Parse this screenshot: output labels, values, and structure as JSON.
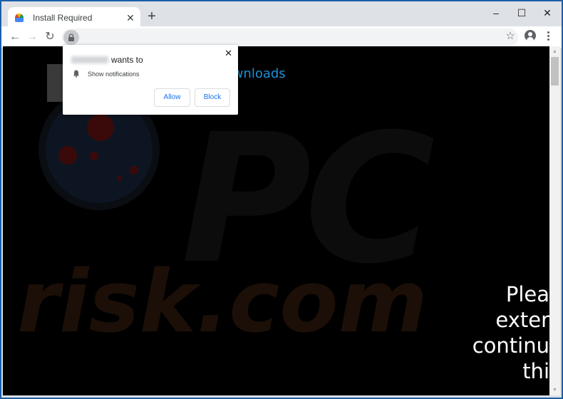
{
  "browser": {
    "tab": {
      "title": "Install Required",
      "favicon": "chrome-installer-icon"
    },
    "new_tab_label": "+",
    "window_controls": {
      "minimize": "–",
      "maximize": "☐",
      "close": "✕"
    },
    "nav": {
      "back": "←",
      "forward": "→",
      "reload": "↻"
    },
    "address_bar": {
      "url": "",
      "secure_icon": "lock-icon"
    },
    "bookmark_icon": "☆",
    "tab_close": "✕"
  },
  "notification_prompt": {
    "origin": "",
    "wants_to": "wants to",
    "permission": "Show notifications",
    "allow_label": "Allow",
    "block_label": "Block",
    "close_label": "✕"
  },
  "page": {
    "heading": "limited Downloads",
    "heading_color": "#1e8fd6",
    "body_lines": [
      "Plea",
      "exter",
      "continu",
      "thi"
    ]
  },
  "watermark": {
    "top": "PC",
    "bottom": "risk.com"
  },
  "scrollbar": {
    "up": "▲",
    "down": "▼"
  }
}
